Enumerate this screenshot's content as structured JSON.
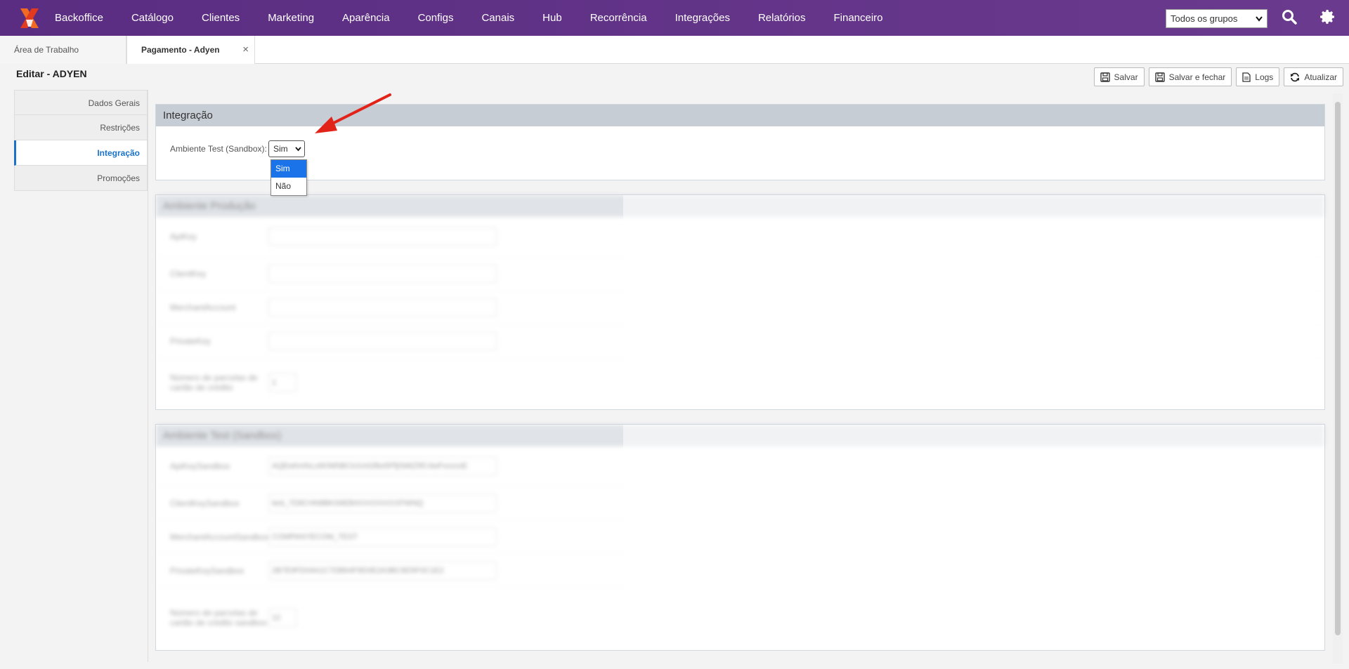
{
  "nav": {
    "items": [
      "Backoffice",
      "Catálogo",
      "Clientes",
      "Marketing",
      "Aparência",
      "Configs",
      "Canais",
      "Hub",
      "Recorrência",
      "Integrações",
      "Relatórios",
      "Financeiro"
    ],
    "group_select": "Todos os grupos",
    "accent": "#5a2d82"
  },
  "tabs": {
    "workspace": "Área de Trabalho",
    "active": "Pagamento - Adyen",
    "close": "×"
  },
  "page": {
    "title": "Editar - ADYEN"
  },
  "toolbar": {
    "save": "Salvar",
    "save_close": "Salvar e fechar",
    "logs": "Logs",
    "refresh": "Atualizar"
  },
  "sidebar": {
    "items": [
      "Dados Gerais",
      "Restrições",
      "Integração",
      "Promoções"
    ],
    "active_index": 2
  },
  "integration": {
    "title": "Integração",
    "sandbox_label": "Ambiente Test (Sandbox):",
    "sandbox_value": "Sim",
    "options": [
      "Sim",
      "Não"
    ]
  },
  "production": {
    "title": "Ambiente Produção",
    "fields": [
      {
        "label": "ApiKey",
        "value": ""
      },
      {
        "label": "ClientKey",
        "value": ""
      },
      {
        "label": "MerchantAccount",
        "value": ""
      },
      {
        "label": "PrivateKey",
        "value": ""
      },
      {
        "label": "Número de parcelas de cartão de crédito",
        "value": "1"
      }
    ]
  },
  "sandbox": {
    "title": "Ambiente Test (Sandbox)",
    "fields": [
      {
        "label": "ApiKeySandbox",
        "value": "AQEwhmfxLo9OMhBCiUUnGfbs5PfjSMtZ5fC4wFxxxxxE"
      },
      {
        "label": "ClientKeySandbox",
        "value": "test_7D8CHN8BKS6EB4XXXXXXXXFWNQ"
      },
      {
        "label": "MerchantAccountSandbox",
        "value": "COMPANYECOM_TEST"
      },
      {
        "label": "PrivateKeySandbox",
        "value": "2B7E9FD04A1C7DB64F9D0E2A3BC9D5F0C1E2"
      },
      {
        "label": "Número de parcelas de cartão de crédito sandbox",
        "value": "12"
      }
    ]
  }
}
